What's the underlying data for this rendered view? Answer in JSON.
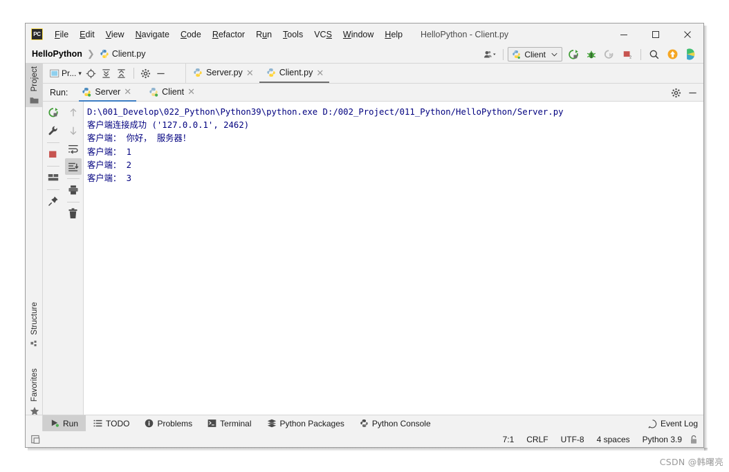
{
  "window": {
    "title": "HelloPython - Client.py",
    "logo_text": "PC"
  },
  "menubar": {
    "items": [
      {
        "label": "File",
        "mnemonic": "F"
      },
      {
        "label": "Edit",
        "mnemonic": "E"
      },
      {
        "label": "View",
        "mnemonic": "V"
      },
      {
        "label": "Navigate",
        "mnemonic": "N"
      },
      {
        "label": "Code",
        "mnemonic": "C"
      },
      {
        "label": "Refactor",
        "mnemonic": "R"
      },
      {
        "label": "Run",
        "mnemonic": "u"
      },
      {
        "label": "Tools",
        "mnemonic": "T"
      },
      {
        "label": "VCS",
        "mnemonic": "S"
      },
      {
        "label": "Window",
        "mnemonic": "W"
      },
      {
        "label": "Help",
        "mnemonic": "H"
      }
    ],
    "minimize": "—",
    "maximize": "☐",
    "close": "✕"
  },
  "navbar": {
    "project": "HelloPython",
    "separator": "❯",
    "file": "Client.py",
    "run_config": "Client",
    "run_config_caret": "⌄"
  },
  "stripe": {
    "items": [
      {
        "label": "Project",
        "active": true
      },
      {
        "label": "Structure",
        "active": false
      },
      {
        "label": "Favorites",
        "active": false
      }
    ]
  },
  "project_panel": {
    "combo_label": "Pr...",
    "combo_caret": "▾"
  },
  "editor_tabs": [
    {
      "label": "Server.py",
      "active": false,
      "close": "✕"
    },
    {
      "label": "Client.py",
      "active": true,
      "close": "✕"
    }
  ],
  "run_window": {
    "label": "Run:",
    "tabs": [
      {
        "label": "Server",
        "active": true,
        "close": "✕"
      },
      {
        "label": "Client",
        "active": false,
        "close": "✕"
      }
    ]
  },
  "console": {
    "lines": [
      "D:\\001_Develop\\022_Python\\Python39\\python.exe D:/002_Project/011_Python/HelloPython/Server.py",
      "客户端连接成功 ('127.0.0.1', 2462)",
      "客户端： 你好， 服务器！",
      "客户端： 1",
      "客户端： 2",
      "客户端： 3"
    ],
    "text_color": "#00007f"
  },
  "bottom_bar": {
    "items": [
      {
        "label": "Run",
        "icon": "run-icon",
        "active": true
      },
      {
        "label": "TODO",
        "icon": "todo-icon",
        "active": false
      },
      {
        "label": "Problems",
        "icon": "problems-icon",
        "active": false
      },
      {
        "label": "Terminal",
        "icon": "terminal-icon",
        "active": false
      },
      {
        "label": "Python Packages",
        "icon": "packages-icon",
        "active": false
      },
      {
        "label": "Python Console",
        "icon": "python-console-icon",
        "active": false
      }
    ],
    "event_log": "Event Log"
  },
  "status_bar": {
    "caret": "7:1",
    "line_separator": "CRLF",
    "encoding": "UTF-8",
    "indent": "4 spaces",
    "interpreter": "Python 3.9"
  },
  "watermark": "CSDN @韩曙亮",
  "colors": {
    "accent_blue": "#3d7ec4",
    "console_text": "#00007f",
    "panel_bg": "#f2f2f2",
    "active_tab_bg": "#cfcfcf",
    "logo_yellow": "#f4d84b"
  }
}
